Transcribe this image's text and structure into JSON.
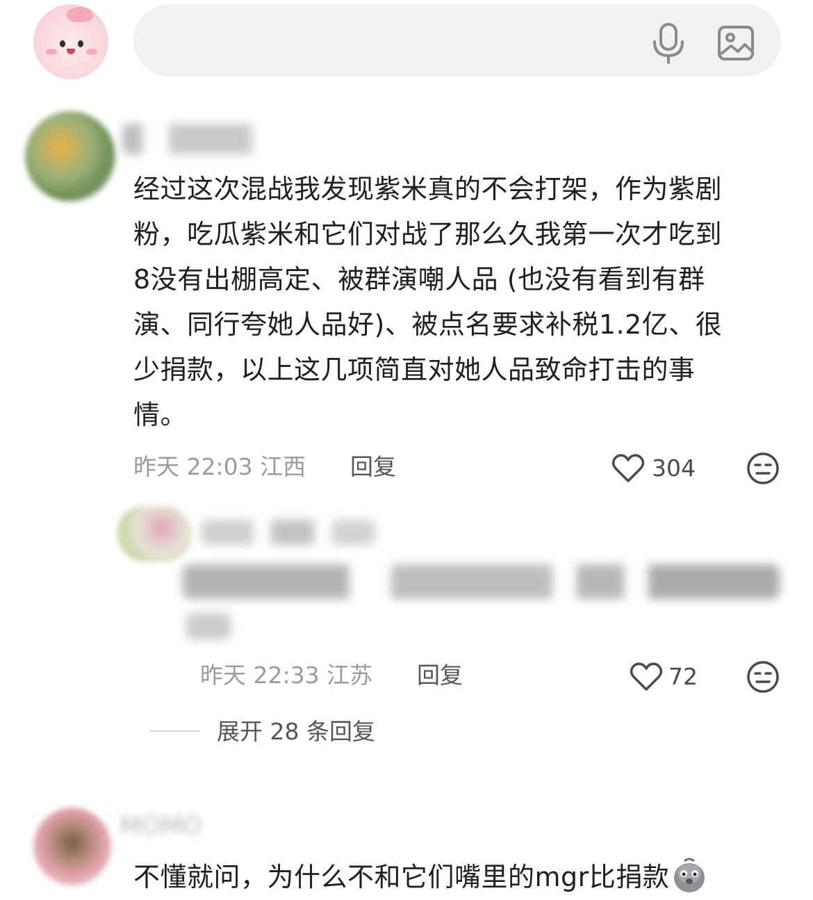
{
  "search": {
    "placeholder": ""
  },
  "comments": [
    {
      "username": "",
      "text": "经过这次混战我发现紫米真的不会打架，作为紫剧粉，吃瓜紫米和它们对战了那么久我第一次才吃到 8没有出棚高定、被群演嘲人品 (也没有看到有群演、同行夸她人品好)、被点名要求补税1.2亿、很少捐款，以上这几项简直对她人品致命打击的事情。",
      "lines": [
        "经过这次混战我发现紫米真的不会打架，作为紫剧",
        "粉，吃瓜紫米和它们对战了那么久我第一次才吃到",
        " 8没有出棚高定、被群演嘲人品 (也没有看到有群",
        "演、同行夸她人品好)、被点名要求补税1.2亿、很",
        "少捐款，以上这几项简直对她人品致命打击的事",
        "情。"
      ],
      "time": "昨天 22:03",
      "location": "江西",
      "reply_label": "回复",
      "likes": "304",
      "reply": {
        "username": "",
        "text": "",
        "time": "昨天 22:33",
        "location": "江苏",
        "reply_label": "回复",
        "likes": "72"
      },
      "expand_label": "展开 28 条回复"
    },
    {
      "username": "MOMO",
      "text": "不懂就问，为什么不和它们嘴里的mgr比捐款"
    }
  ],
  "icons": {
    "mic": "microphone-icon",
    "image": "image-icon",
    "like": "heart-icon",
    "dislike": "neutral-face-icon",
    "emoji": "pigeon-emoji-icon"
  },
  "colors": {
    "text": "#1f1f1f",
    "meta": "#9b9b9b",
    "search_bg": "#f1f1f2"
  }
}
